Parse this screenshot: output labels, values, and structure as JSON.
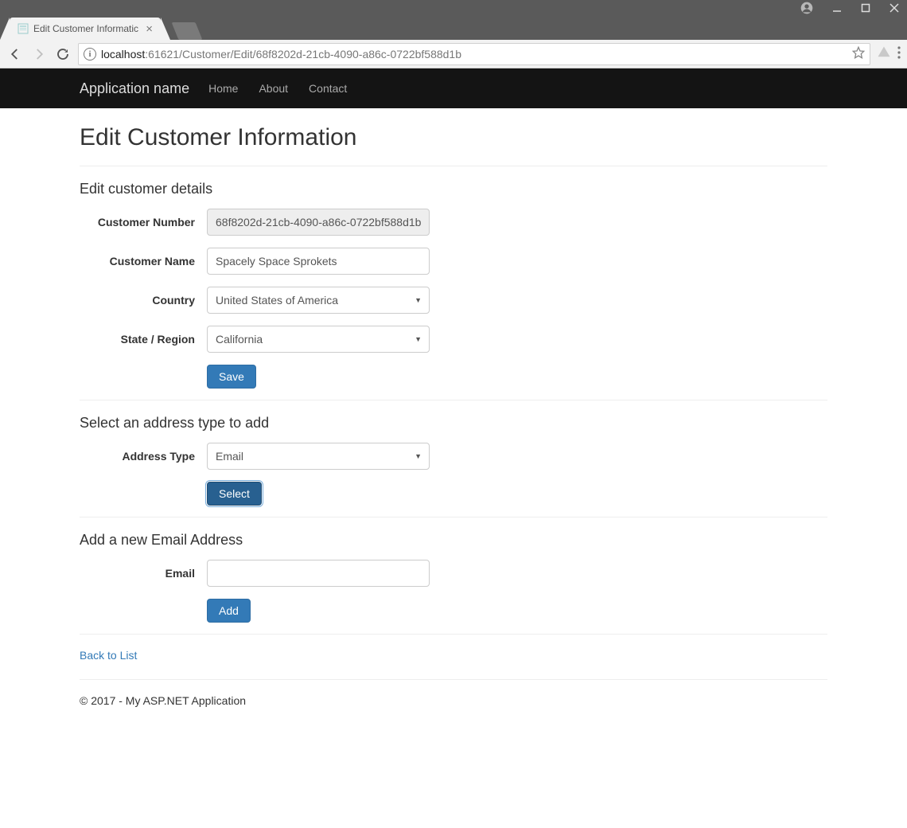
{
  "window": {
    "tab_title": "Edit Customer Informatic"
  },
  "browser": {
    "url_host": "localhost",
    "url_port": ":61621",
    "url_path": "/Customer/Edit/68f8202d-21cb-4090-a86c-0722bf588d1b"
  },
  "navbar": {
    "brand": "Application name",
    "links": [
      "Home",
      "About",
      "Contact"
    ]
  },
  "page": {
    "title": "Edit Customer Information"
  },
  "section_details": {
    "heading": "Edit customer details",
    "fields": {
      "customer_number_label": "Customer Number",
      "customer_number_value": "68f8202d-21cb-4090-a86c-0722bf588d1b",
      "customer_name_label": "Customer Name",
      "customer_name_value": "Spacely Space Sprokets",
      "country_label": "Country",
      "country_value": "United States of America",
      "region_label": "State / Region",
      "region_value": "California"
    },
    "save_label": "Save"
  },
  "section_address_type": {
    "heading": "Select an address type to add",
    "address_type_label": "Address Type",
    "address_type_value": "Email",
    "select_label": "Select"
  },
  "section_email": {
    "heading": "Add a new Email Address",
    "email_label": "Email",
    "email_value": "",
    "add_label": "Add"
  },
  "back_link": "Back to List",
  "footer": "© 2017 - My ASP.NET Application"
}
